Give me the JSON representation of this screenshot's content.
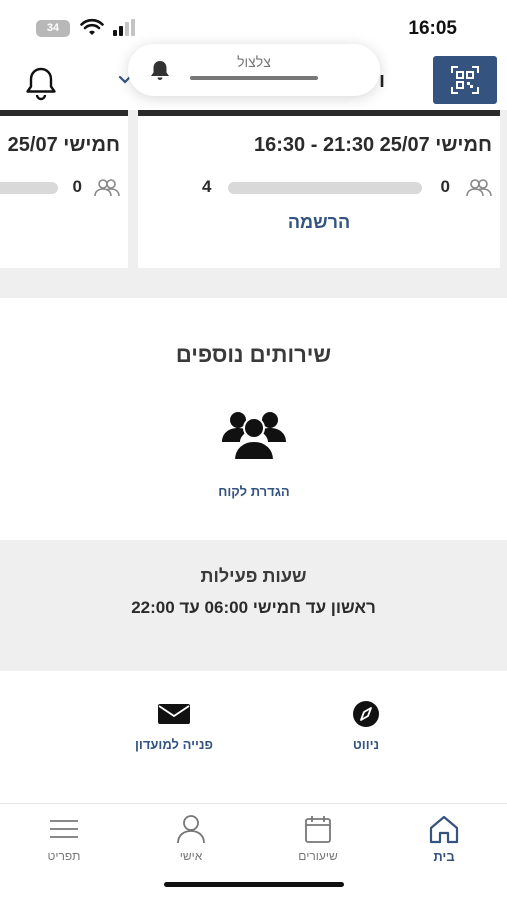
{
  "status_bar": {
    "time": "16:05",
    "battery": "34"
  },
  "header": {
    "edge_text": "ו",
    "notification": {
      "label": "צלצול"
    },
    "qr_icon": "qr-scan-icon",
    "bell_icon": "bell-icon"
  },
  "carousel": {
    "main_card": {
      "title": "חמישי 25/07 21:30 - 16:30",
      "count_left": "0",
      "capacity": "4",
      "progress": 0,
      "register_label": "הרשמה"
    },
    "left_card": {
      "title": "חמישי 25/07",
      "count": "0",
      "progress": 0
    }
  },
  "services": {
    "title": "שירותים נוספים",
    "client_setup_label": "הגדרת לקוח"
  },
  "hours": {
    "title": "שעות פעילות",
    "text": "ראשון עד חמישי 06:00 עד 22:00"
  },
  "quick_actions": {
    "navigation_label": "ניווט",
    "contact_label": "פנייה למועדון"
  },
  "tabbar": {
    "home": "בית",
    "classes": "שיעורים",
    "personal": "אישי",
    "menu": "תפריט"
  },
  "colors": {
    "accent": "#34537f",
    "dark": "#2b2b2b",
    "gray_bg": "#efefef"
  }
}
